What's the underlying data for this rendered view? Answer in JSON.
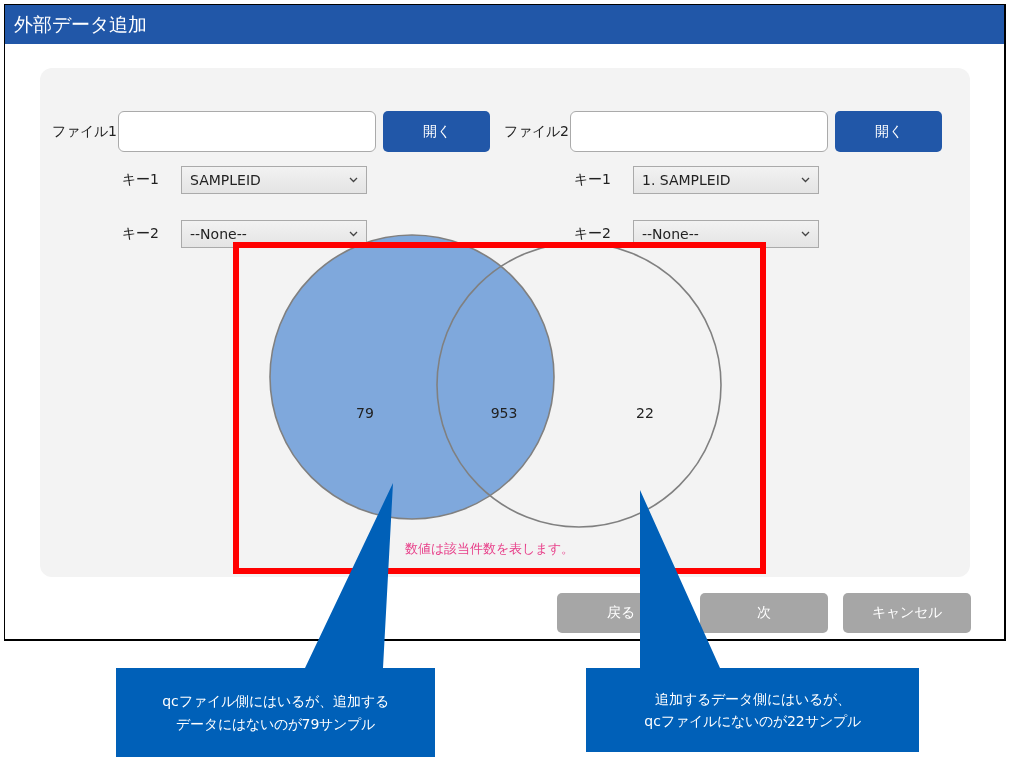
{
  "window": {
    "title": "外部データ追加"
  },
  "files": [
    {
      "label": "ファイル1",
      "button": "開く",
      "keys": [
        {
          "label": "キー1",
          "value": "SAMPLEID"
        },
        {
          "label": "キー2",
          "value": "--None--"
        }
      ]
    },
    {
      "label": "ファイル2",
      "button": "開く",
      "keys": [
        {
          "label": "キー1",
          "value": "1. SAMPLEID"
        },
        {
          "label": "キー2",
          "value": "--None--"
        }
      ]
    }
  ],
  "venn": {
    "circles": [
      {
        "highlighted": true
      },
      {
        "highlighted": false
      }
    ],
    "counts": [
      "79",
      "953",
      "22"
    ],
    "caption": "数値は該当件数を表します。"
  },
  "buttons": [
    {
      "label": "戻る",
      "disabled": true
    },
    {
      "label": "次",
      "disabled": true
    },
    {
      "label": "キャンセル",
      "disabled": true
    }
  ],
  "callouts": [
    {
      "lines": [
        "qcファイル側にはいるが、追加する",
        "データにはないのが79サンプル"
      ]
    },
    {
      "lines": [
        "追加するデータ側にはいるが、",
        "qcファイルにないのが22サンプル"
      ]
    }
  ]
}
